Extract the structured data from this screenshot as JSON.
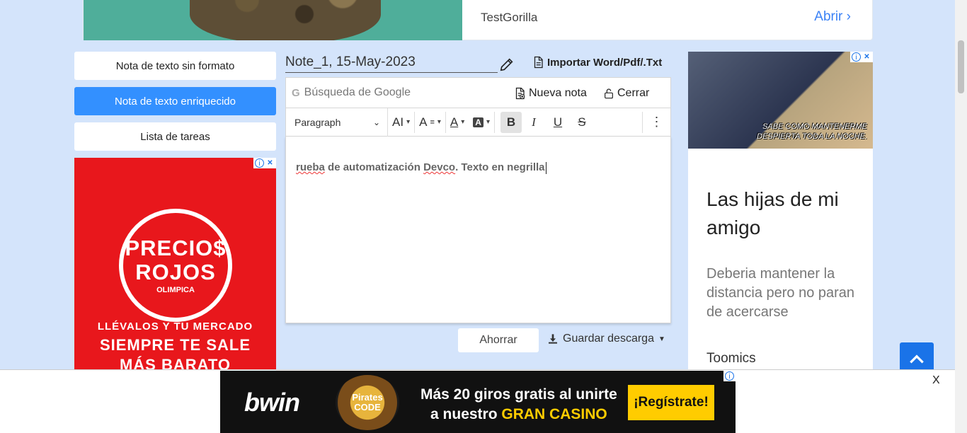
{
  "top_ad": {
    "brand": "TestGorilla",
    "open_label": "Abrir"
  },
  "menu": {
    "items": [
      {
        "label": "Nota de texto sin formato"
      },
      {
        "label": "Nota de texto enriquecido"
      },
      {
        "label": "Lista de tareas"
      }
    ]
  },
  "left_ad": {
    "line_a": "PRECIO$",
    "line_b": "ROJOS",
    "sub": "OLIMPICA",
    "slogan1": "LLÉVALOS Y TU MERCADO",
    "slogan2": "SIEMPRE TE SALE",
    "slogan3": "MÁS BARATO"
  },
  "note": {
    "title": "Note_1, 15-May-2023",
    "import_label": "Importar Word/Pdf/.Txt"
  },
  "bar1": {
    "search_placeholder": "Búsqueda de Google",
    "new_note_label": "Nueva nota",
    "close_label": "Cerrar"
  },
  "toolbar": {
    "paragraph": "Paragraph",
    "font_size": "AI",
    "font_format": "A",
    "font_color": "A",
    "highlight": "A",
    "bold": "B",
    "italic": "I",
    "underline": "U",
    "strike": "S",
    "more": "⋮"
  },
  "editor": {
    "word1": "rueba",
    "text_mid": " de automatización ",
    "word2": "Devco",
    "text_end": ". Texto en negrilla"
  },
  "actions": {
    "save_label": "Ahorrar",
    "download_label": "Guardar descarga"
  },
  "right_ad": {
    "caption_line1": "SABE COMO MANTENERME",
    "caption_line2": "DESPIERTA TODA LA NOCHE.",
    "headline": "Las hijas de mi amigo",
    "description": "Deberia mantener la distancia pero no paran de acercarse",
    "source": "Toomics"
  },
  "bottom_ad": {
    "brand": "bwin",
    "game_line1": "Pirates",
    "game_line2": "CODE",
    "msg_line1": "Más 20 giros gratis al unirte",
    "msg_prefix": "a nuestro ",
    "msg_highlight": "GRAN CASINO",
    "cta": "¡Regístrate!",
    "close": "X"
  },
  "colors": {
    "accent": "#3390ff",
    "background": "#d4e4fb",
    "up_button": "#1a73e8"
  }
}
